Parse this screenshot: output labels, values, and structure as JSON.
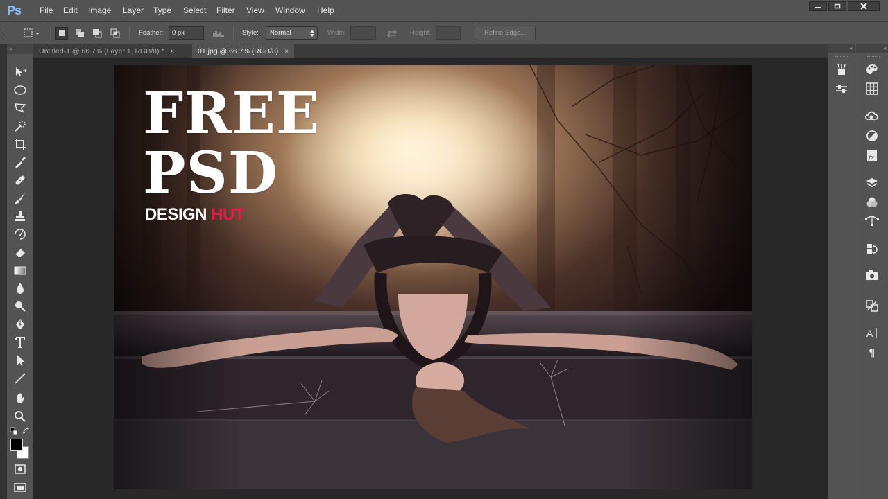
{
  "app": {
    "logo": "Ps"
  },
  "menu": [
    "File",
    "Edit",
    "Image",
    "Layer",
    "Type",
    "Select",
    "Filter",
    "View",
    "Window",
    "Help"
  ],
  "window_controls": [
    "minimize-icon",
    "restore-icon",
    "close-icon"
  ],
  "options": {
    "feather_label": "Feather:",
    "feather_value": "0 px",
    "style_label": "Style:",
    "style_value": "Normal",
    "width_label": "Width:",
    "height_label": "Height:",
    "refine_edge": "Refine Edge..."
  },
  "tabs": [
    {
      "label": "Untitled-1 @ 66.7% (Layer 1, RGB/8) *",
      "close": "×"
    },
    {
      "label": "01.jpg @ 66.7% (RGB/8)",
      "close": "×"
    }
  ],
  "tools": [
    "move-tool-icon",
    "elliptical-marquee-icon",
    "polygonal-lasso-icon",
    "quick-selection-icon",
    "crop-icon",
    "eyedropper-icon",
    "spot-healing-icon",
    "brush-icon",
    "clone-stamp-icon",
    "history-brush-icon",
    "eraser-icon",
    "gradient-icon",
    "blur-icon",
    "dodge-icon",
    "pen-icon",
    "type-icon",
    "path-selection-icon",
    "line-icon",
    "hand-icon",
    "zoom-icon"
  ],
  "colors": {
    "foreground": "#000000",
    "background": "#ffffff",
    "accent_hut": "#e6194b",
    "ps_blue": "#7ec3ff"
  },
  "artwork": {
    "title_line1": "FREE",
    "title_line2": "PSD",
    "sub_white": "DESIGN",
    "sub_accent": "HUT"
  },
  "right_panels": {
    "narrow": [
      "tool-presets-icon",
      "adjust-presets-icon"
    ],
    "wide": [
      "color-icon",
      "swatches-icon",
      "libraries-icon",
      "adjustments-icon",
      "styles-icon",
      "layers-icon",
      "channels-icon",
      "paths-icon",
      "history-icon",
      "properties-icon",
      "clone-source-icon",
      "character-icon",
      "paragraph-icon"
    ]
  }
}
